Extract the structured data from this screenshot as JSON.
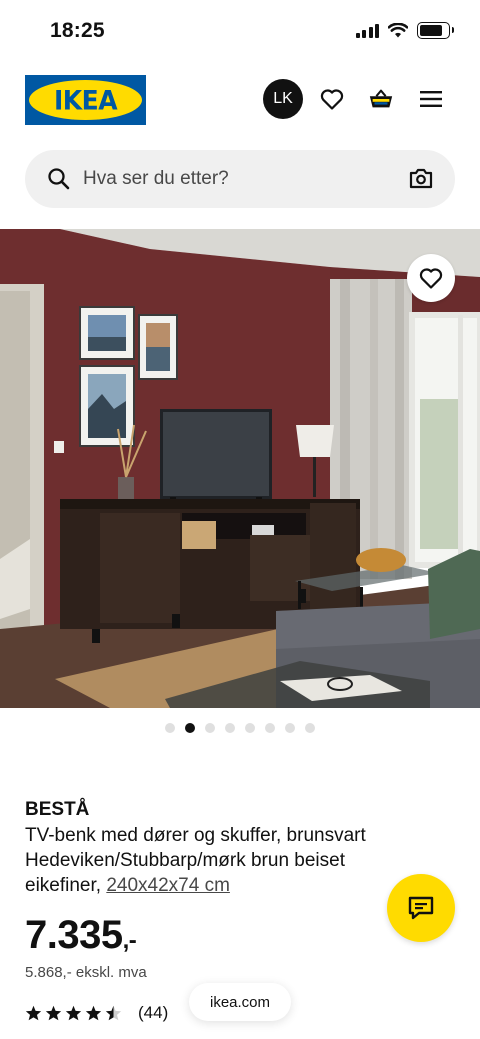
{
  "status_bar": {
    "time": "18:25"
  },
  "header": {
    "logo_text": "IKEA",
    "avatar_initials": "LK",
    "icons": [
      "heart-icon",
      "basket-icon",
      "menu-icon"
    ]
  },
  "search": {
    "placeholder": "Hva ser du etter?"
  },
  "gallery": {
    "slide_count": 8,
    "active_index": 1
  },
  "product": {
    "brand": "BESTÅ",
    "description": "TV-benk med dører og skuffer, brunsvart Hedeviken/Stubbarp/mørk brun beiset eikefiner, ",
    "dimensions": "240x42x74 cm",
    "price_main": "7.335",
    "price_suffix": ",-",
    "price_ex_vat": "5.868,- ekskl. mva",
    "rating_value": 4.5,
    "rating_max": 5,
    "review_count": "(44)"
  },
  "browser": {
    "url": "ikea.com"
  },
  "colors": {
    "ikea_blue": "#0058a3",
    "ikea_yellow": "#ffdb00",
    "wall": "#6e2e2f",
    "cabinet": "#2e211b"
  }
}
